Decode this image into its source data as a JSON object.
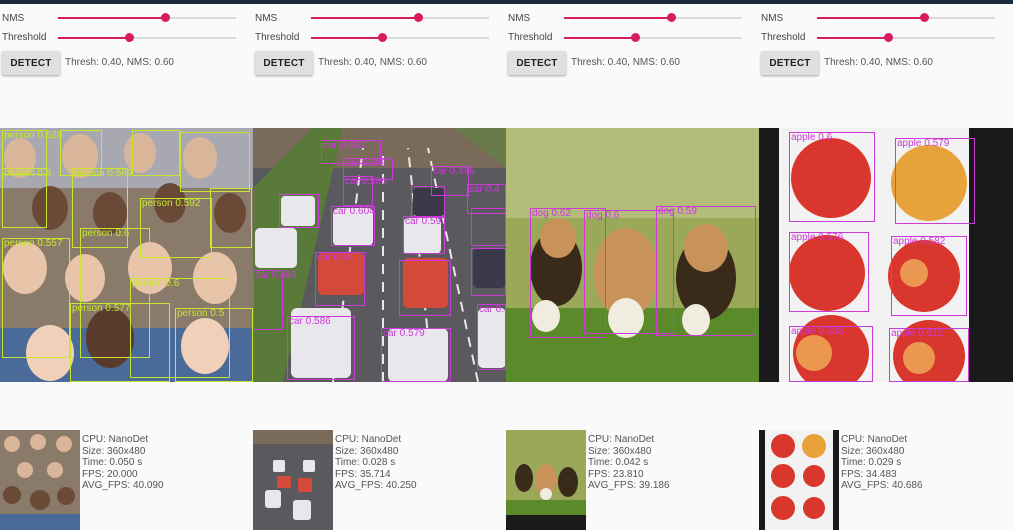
{
  "colors": {
    "accent": "#d81b60",
    "topbar": "#1b2a3c",
    "person_box": "#c8e630",
    "object_box": "#cc3ad8"
  },
  "panels": [
    {
      "nms_label": "NMS",
      "threshold_label": "Threshold",
      "nms_value": 0.6,
      "threshold_value": 0.4,
      "detect_label": "DETECT",
      "status": "Thresh: 0.40, NMS: 0.60",
      "scene": "crowd-photo",
      "info": {
        "cpu": "CPU: NanoDet",
        "size": "Size: 360x480",
        "time": "Time: 0.050 s",
        "fps": "FPS: 20.000",
        "avg_fps": "AVG_FPS: 40.090"
      },
      "labels": [
        "person 0.628",
        "person 0.6",
        "person 0.589",
        "person 0.592",
        "person 0.557",
        "person 0.6",
        "person 0.6",
        "person 0.577",
        "person 0.5"
      ]
    },
    {
      "nms_label": "NMS",
      "threshold_label": "Threshold",
      "nms_value": 0.6,
      "threshold_value": 0.4,
      "detect_label": "DETECT",
      "status": "Thresh: 0.40, NMS: 0.60",
      "scene": "traffic-photo",
      "info": {
        "cpu": "CPU: NanoDet",
        "size": "Size: 360x480",
        "time": "Time: 0.028 s",
        "fps": "FPS: 35.714",
        "avg_fps": "AVG_FPS: 40.250"
      },
      "labels": [
        "car 0.481",
        "car 0.609",
        "car 0.586",
        "car 0.446",
        "car 0.4",
        "car 0.604",
        "car 0.59",
        "car 0.54",
        "car 0.483",
        "car 0.586",
        "car 0.579",
        "car 0.4"
      ]
    },
    {
      "nms_label": "NMS",
      "threshold_label": "Threshold",
      "nms_value": 0.6,
      "threshold_value": 0.4,
      "detect_label": "DETECT",
      "status": "Thresh: 0.40, NMS: 0.60",
      "scene": "puppies-photo",
      "info": {
        "cpu": "CPU: NanoDet",
        "size": "Size: 360x480",
        "time": "Time: 0.042 s",
        "fps": "FPS: 23.810",
        "avg_fps": "AVG_FPS: 39.186"
      },
      "labels": [
        "dog 0.62",
        "dog 0.6",
        "dog 0.59"
      ]
    },
    {
      "nms_label": "NMS",
      "threshold_label": "Threshold",
      "nms_value": 0.6,
      "threshold_value": 0.4,
      "detect_label": "DETECT",
      "status": "Thresh: 0.40, NMS: 0.60",
      "scene": "apples-photo",
      "info": {
        "cpu": "CPU: NanoDet",
        "size": "Size: 360x480",
        "time": "Time: 0.029 s",
        "fps": "FPS: 34.483",
        "avg_fps": "AVG_FPS: 40.686"
      },
      "labels": [
        "apple 0.6",
        "apple 0.579",
        "apple 0.576",
        "apple 0.582",
        "apple 0.583",
        "apple 0.612"
      ]
    }
  ]
}
